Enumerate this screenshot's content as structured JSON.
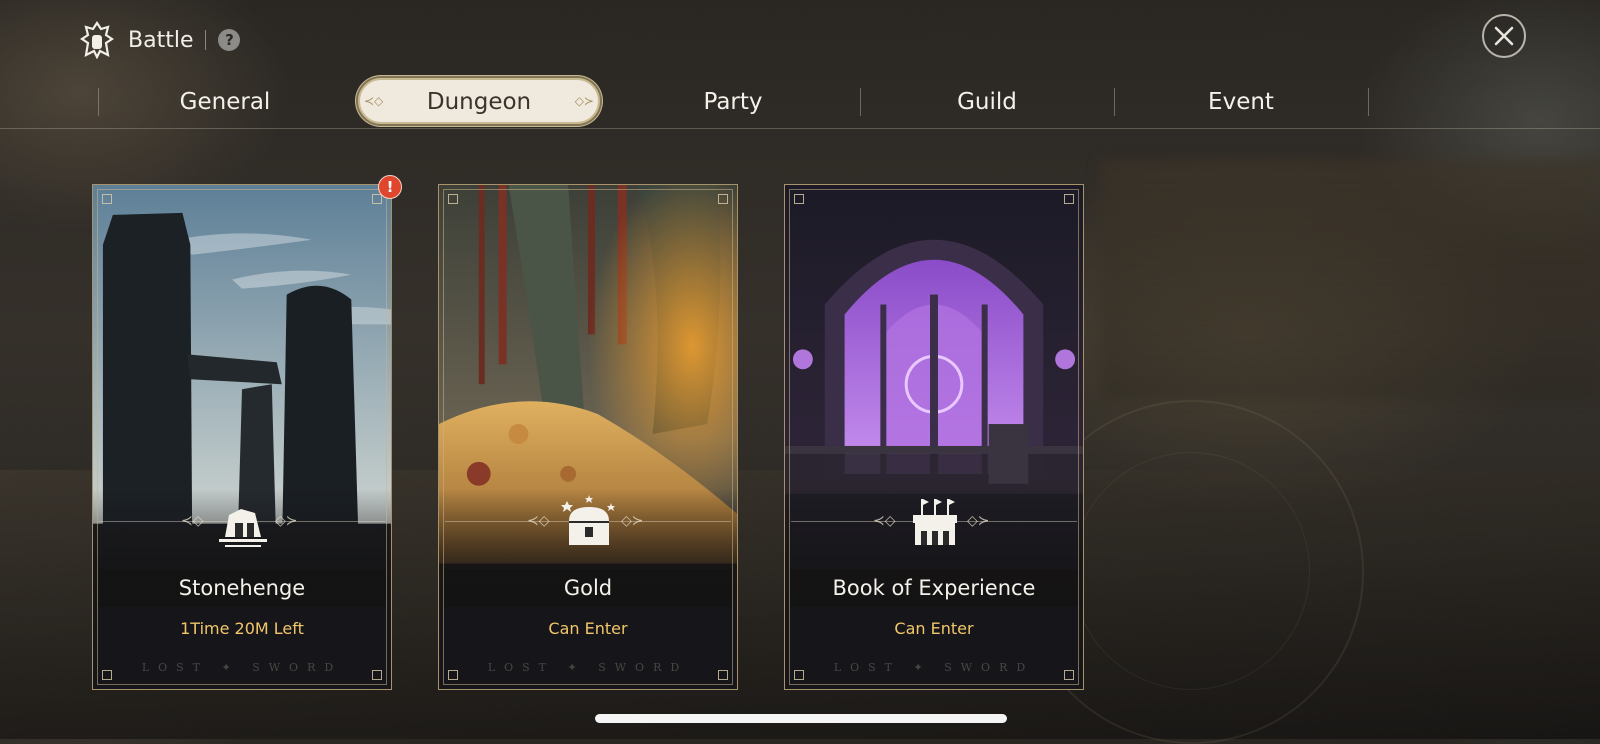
{
  "header": {
    "title": "Battle",
    "help_icon": "?"
  },
  "tabs": [
    {
      "label": "General",
      "active": false
    },
    {
      "label": "Dungeon",
      "active": true
    },
    {
      "label": "Party",
      "active": false
    },
    {
      "label": "Guild",
      "active": false
    },
    {
      "label": "Event",
      "active": false
    }
  ],
  "cards": [
    {
      "name": "Stonehenge",
      "status": "1Time 20M Left",
      "icon": "stonehenge-icon",
      "alert": "!"
    },
    {
      "name": "Gold",
      "status": "Can Enter",
      "icon": "treasure-chest-icon"
    },
    {
      "name": "Book of Experience",
      "status": "Can Enter",
      "icon": "fortress-icon"
    }
  ],
  "brand_watermark": "LOST ✦ SWORD",
  "colors": {
    "status_text": "#f2c66a",
    "accent_border": "#a8926a",
    "alert": "#e0452d"
  }
}
